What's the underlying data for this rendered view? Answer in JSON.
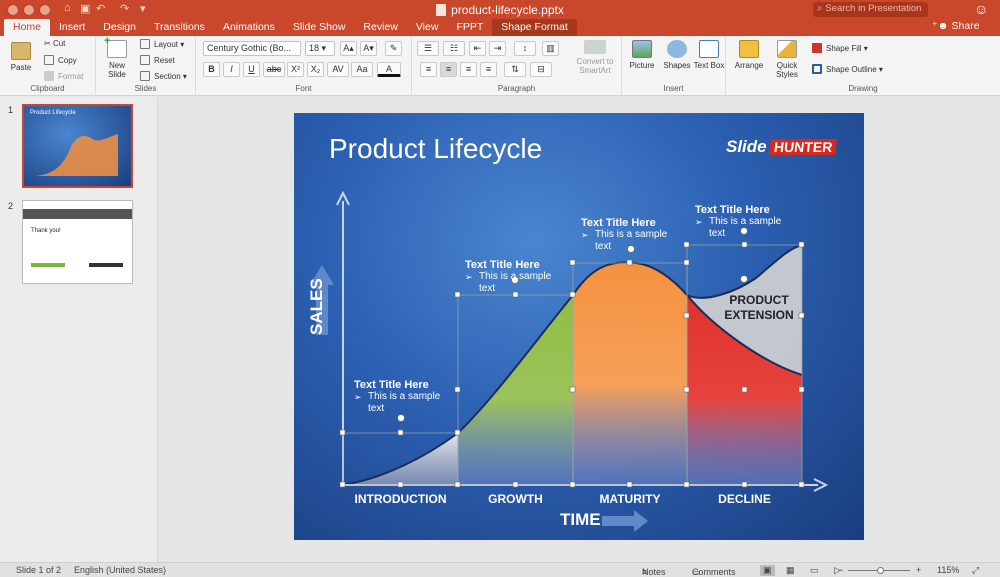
{
  "window": {
    "doc_title": "product-lifecycle.pptx",
    "search_placeholder": "Search in Presentation",
    "share_label": "Share",
    "tabs": [
      {
        "label": "Home",
        "active": true
      },
      {
        "label": "Insert"
      },
      {
        "label": "Design"
      },
      {
        "label": "Transitions"
      },
      {
        "label": "Animations"
      },
      {
        "label": "Slide Show"
      },
      {
        "label": "Review"
      },
      {
        "label": "View"
      },
      {
        "label": "FPPT"
      },
      {
        "label": "Shape Format",
        "contextual": true
      }
    ]
  },
  "ribbon": {
    "clipboard": {
      "label": "Clipboard",
      "paste": "Paste",
      "cut": "Cut",
      "copy": "Copy",
      "format": "Format"
    },
    "slides": {
      "label": "Slides",
      "new_slide": "New Slide",
      "layout": "Layout",
      "reset": "Reset",
      "section": "Section"
    },
    "font": {
      "label": "Font",
      "font_name": "Century Gothic (Bo...",
      "font_size": "18",
      "bold": "B",
      "italic": "I",
      "underline": "U",
      "strike": "abc",
      "superscript": "X²",
      "subscript": "X₂",
      "spacing": "AV",
      "case": "Aa",
      "color": "A"
    },
    "paragraph": {
      "label": "Paragraph",
      "convert_smartart": "Convert to SmartArt"
    },
    "insert": {
      "label": "Insert",
      "picture": "Picture",
      "shapes": "Shapes",
      "text_box": "Text Box"
    },
    "drawing": {
      "label": "Drawing",
      "arrange": "Arrange",
      "quick_styles": "Quick Styles",
      "shape_fill": "Shape Fill",
      "shape_outline": "Shape Outline"
    }
  },
  "thumbnails": [
    {
      "number": "1",
      "title": "Product Lifecycle",
      "selected": true
    },
    {
      "number": "2",
      "title": "Thank you!",
      "selected": false
    }
  ],
  "slide": {
    "title": "Product Lifecycle",
    "brand_a": "Slide",
    "brand_b": "HUNTER",
    "y_axis_label": "SALES",
    "x_axis_label": "TIME",
    "product_extension": "PRODUCT EXTENSION",
    "stages": [
      "INTRODUCTION",
      "GROWTH",
      "MATURITY",
      "DECLINE"
    ],
    "text_boxes": [
      {
        "heading": "Text Title Here",
        "body": "This is a sample text"
      },
      {
        "heading": "Text Title Here",
        "body": "This is a sample text"
      },
      {
        "heading": "Text Title Here",
        "body": "This is a sample text"
      },
      {
        "heading": "Text Title Here",
        "body": "This is a sample text"
      }
    ],
    "colors": {
      "introduction": "#c9ccd4",
      "growth": "#8fbf45",
      "maturity": "#f5913f",
      "decline": "#e2312b",
      "extension": "#d0d0d3"
    }
  },
  "status": {
    "slide_counter": "Slide 1 of 2",
    "language": "English (United States)",
    "notes": "Notes",
    "comments": "Comments",
    "zoom": "115%"
  }
}
